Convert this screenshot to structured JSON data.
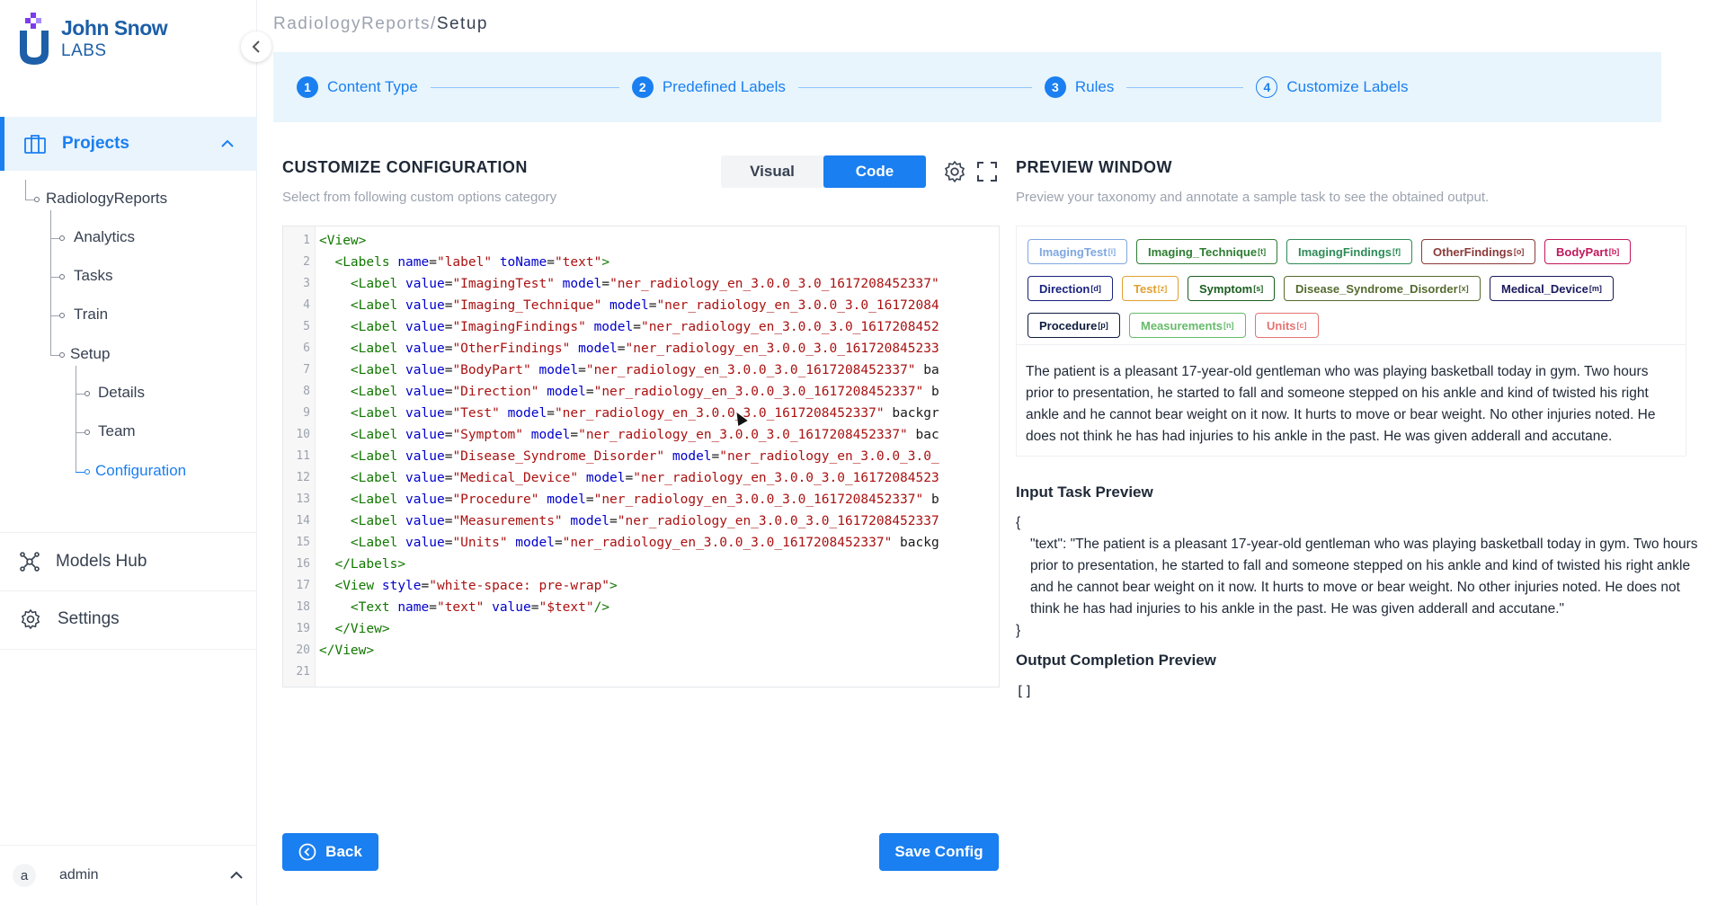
{
  "brand": {
    "name": "John Snow",
    "sub": "LABS"
  },
  "sidebar": {
    "projects_label": "Projects",
    "tree": {
      "project": "RadiologyReports",
      "analytics": "Analytics",
      "tasks": "Tasks",
      "train": "Train",
      "setup": "Setup",
      "details": "Details",
      "team": "Team",
      "configuration": "Configuration"
    },
    "models_hub": "Models Hub",
    "settings": "Settings",
    "user": {
      "initial": "a",
      "name": "admin"
    }
  },
  "breadcrumb": {
    "project": "RadiologyReports",
    "sep": "/",
    "current": "Setup"
  },
  "stepper": [
    {
      "num": "1",
      "label": "Content Type"
    },
    {
      "num": "2",
      "label": "Predefined Labels"
    },
    {
      "num": "3",
      "label": "Rules"
    },
    {
      "num": "4",
      "label": "Customize Labels"
    }
  ],
  "config": {
    "title": "CUSTOMIZE CONFIGURATION",
    "subtitle": "Select from following custom options category",
    "toggle": {
      "visual": "Visual",
      "code": "Code"
    }
  },
  "code_lines": [
    "<View>",
    "  <Labels name=\"label\" toName=\"text\">",
    "    <Label value=\"ImagingTest\" model=\"ner_radiology_en_3.0.0_3.0_1617208452337\"",
    "    <Label value=\"Imaging_Technique\" model=\"ner_radiology_en_3.0.0_3.0_16172084",
    "    <Label value=\"ImagingFindings\" model=\"ner_radiology_en_3.0.0_3.0_1617208452",
    "    <Label value=\"OtherFindings\" model=\"ner_radiology_en_3.0.0_3.0_161720845233",
    "    <Label value=\"BodyPart\" model=\"ner_radiology_en_3.0.0_3.0_1617208452337\" ba",
    "    <Label value=\"Direction\" model=\"ner_radiology_en_3.0.0_3.0_1617208452337\" b",
    "    <Label value=\"Test\" model=\"ner_radiology_en_3.0.0_3.0_1617208452337\" backgr",
    "    <Label value=\"Symptom\" model=\"ner_radiology_en_3.0.0_3.0_1617208452337\" bac",
    "    <Label value=\"Disease_Syndrome_Disorder\" model=\"ner_radiology_en_3.0.0_3.0_",
    "    <Label value=\"Medical_Device\" model=\"ner_radiology_en_3.0.0_3.0_16172084523",
    "    <Label value=\"Procedure\" model=\"ner_radiology_en_3.0.0_3.0_1617208452337\" b",
    "    <Label value=\"Measurements\" model=\"ner_radiology_en_3.0.0_3.0_1617208452337",
    "    <Label value=\"Units\" model=\"ner_radiology_en_3.0.0_3.0_1617208452337\" backg",
    "  </Labels>",
    "  <View style=\"white-space: pre-wrap\">",
    "    <Text name=\"text\" value=\"$text\"/>",
    "  </View>",
    "</View>",
    ""
  ],
  "preview": {
    "title": "PREVIEW WINDOW",
    "subtitle": "Preview your taxonomy and annotate a sample task to see the obtained output.",
    "labels": [
      {
        "text": "ImagingTest",
        "key": "[i]",
        "color": "#7fa7e0"
      },
      {
        "text": "Imaging_Technique",
        "key": "[t]",
        "color": "#2e7d32"
      },
      {
        "text": "ImagingFindings",
        "key": "[f]",
        "color": "#2e8b57"
      },
      {
        "text": "OtherFindings",
        "key": "[o]",
        "color": "#8b3a3a"
      },
      {
        "text": "BodyPart",
        "key": "[b]",
        "color": "#c2185b"
      },
      {
        "text": "Direction",
        "key": "[d]",
        "color": "#1a237e"
      },
      {
        "text": "Test",
        "key": "[z]",
        "color": "#e0a030"
      },
      {
        "text": "Symptom",
        "key": "[s]",
        "color": "#1b5e20"
      },
      {
        "text": "Disease_Syndrome_Disorder",
        "key": "[x]",
        "color": "#556b2f"
      },
      {
        "text": "Medical_Device",
        "key": "[m]",
        "color": "#1a1a5e"
      },
      {
        "text": "Procedure",
        "key": "[p]",
        "color": "#0d1b3e"
      },
      {
        "text": "Measurements",
        "key": "[n]",
        "color": "#66bb6a"
      },
      {
        "text": "Units",
        "key": "[c]",
        "color": "#e57373"
      }
    ],
    "sample_text": "The patient is a pleasant 17-year-old gentleman who was playing basketball today in gym. Two hours prior to presentation, he started to fall and someone stepped on his ankle and kind of twisted his right ankle and he cannot bear weight on it now. It hurts to move or bear weight. No other injuries noted. He does not think he has had injuries to his ankle in the past. He was given adderall and accutane.",
    "input_title": "Input Task Preview",
    "input_open": "{",
    "input_body": "\"text\": \"The patient is a pleasant 17-year-old gentleman who was playing basketball today in gym. Two hours prior to presentation, he started to fall and someone stepped on his ankle and kind of twisted his right ankle and he cannot bear weight on it now. It hurts to move or bear weight. No other injuries noted. He does not think he has had injuries to his ankle in the past. He was given adderall and accutane.\"",
    "input_close": "}",
    "output_title": "Output Completion Preview",
    "output_value": "[]"
  },
  "buttons": {
    "back": "Back",
    "save": "Save Config"
  }
}
